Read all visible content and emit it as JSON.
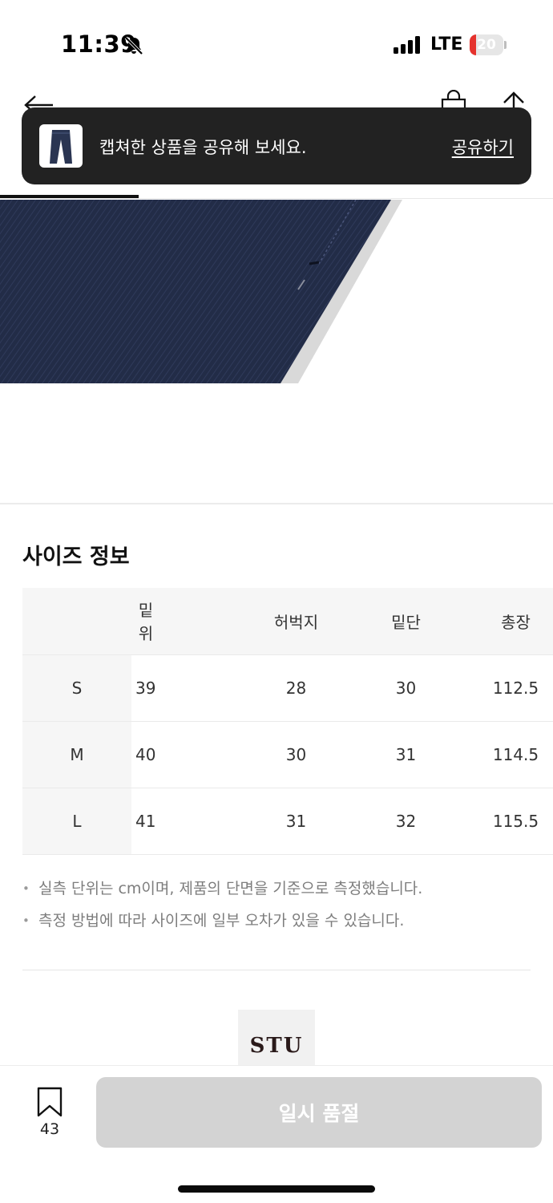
{
  "status_bar": {
    "time": "11:39",
    "network": "LTE",
    "battery_level": "20",
    "battery_fraction": 0.2,
    "icons": [
      "bell-slash-icon",
      "signal-icon",
      "battery-icon"
    ]
  },
  "nav": {
    "icons": [
      "back-arrow-icon",
      "shopping-bag-icon",
      "share-icon"
    ]
  },
  "toast": {
    "message": "캡쳐한 상품을 공유해 보세요.",
    "action": "공유하기",
    "thumbnail_icon": "jeans-icon"
  },
  "size_info": {
    "title": "사이즈 정보",
    "headers": [
      "",
      "밑위",
      "허벅지",
      "밑단",
      "총장"
    ],
    "rows": [
      {
        "size": "S",
        "values": [
          "39",
          "28",
          "30",
          "112.5"
        ]
      },
      {
        "size": "M",
        "values": [
          "40",
          "30",
          "31",
          "114.5"
        ]
      },
      {
        "size": "L",
        "values": [
          "41",
          "31",
          "32",
          "115.5"
        ]
      }
    ],
    "notes": [
      "실측 단위는 cm이며, 제품의 단면을 기준으로 측정했습니다.",
      "측정 방법에 따라 사이즈에 일부 오차가 있을 수 있습니다."
    ]
  },
  "brand": {
    "logo_text": "STU"
  },
  "bottom_bar": {
    "bookmark_count": "43",
    "soldout_label": "일시 품절",
    "bookmark_icon": "bookmark-icon"
  },
  "colors": {
    "denim": "#1f2a44",
    "toast_bg": "#222222",
    "battery_red": "#e5322d",
    "disabled_button": "#d3d3d3"
  }
}
